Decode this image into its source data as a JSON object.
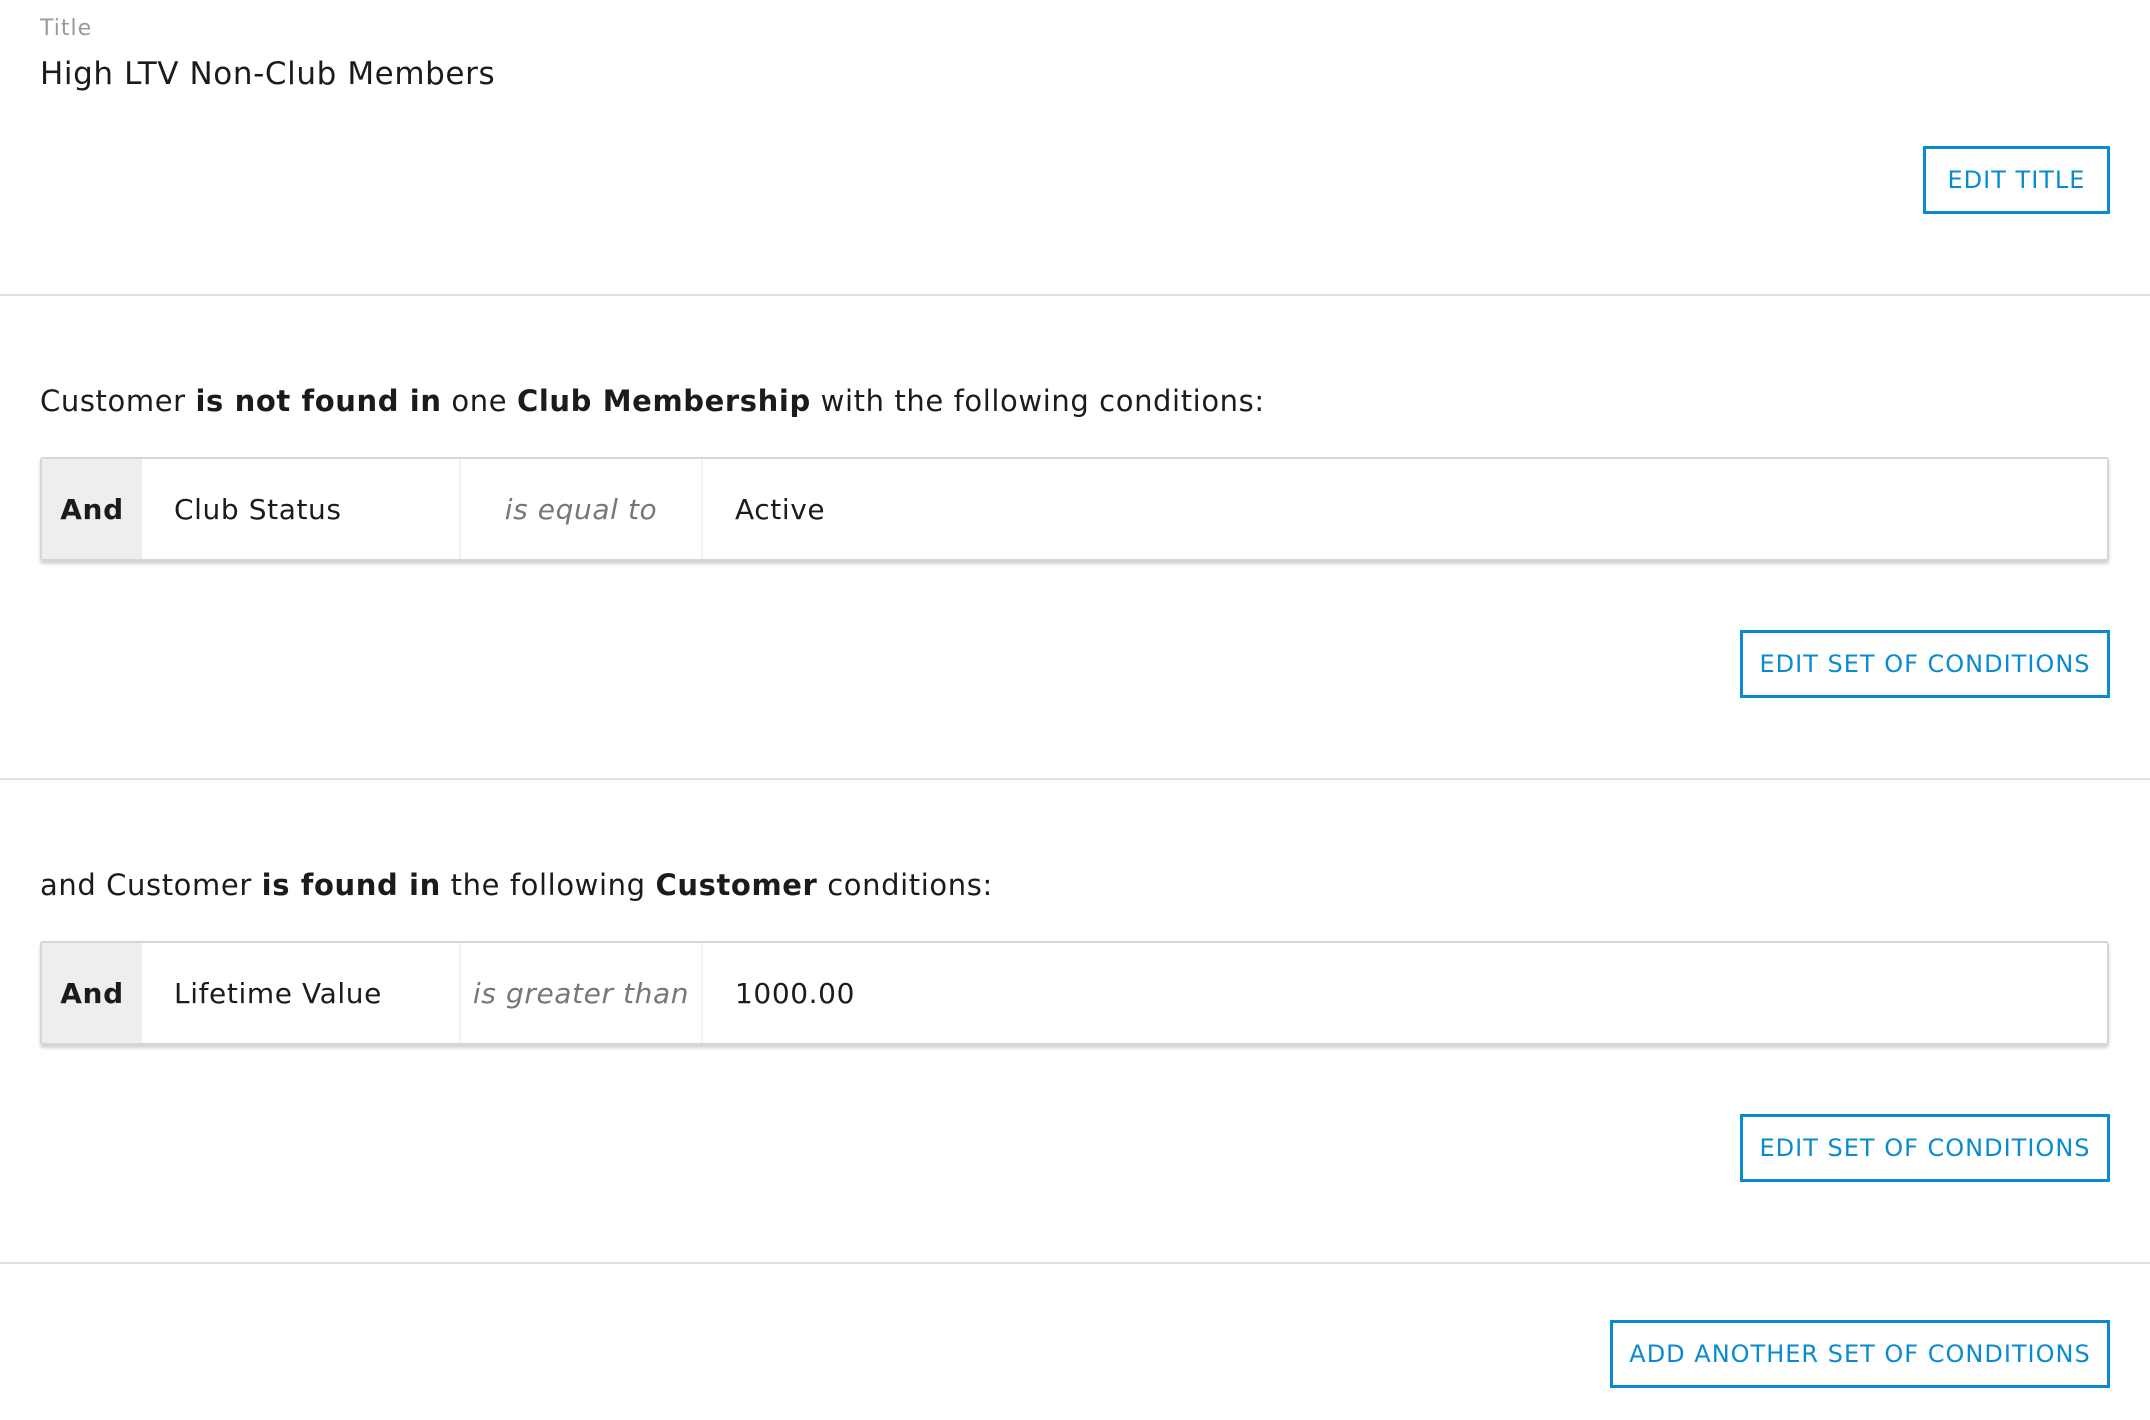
{
  "title_section": {
    "label": "Title",
    "value": "High LTV Non-Club Members",
    "edit_button": "EDIT TITLE"
  },
  "condition_sets": [
    {
      "sentence": {
        "prefix": "Customer ",
        "emph1": "is not found in",
        "mid": " one ",
        "emph2": "Club Membership",
        "suffix": " with the following conditions:"
      },
      "conditions": [
        {
          "conjunction": "And",
          "field": "Club Status",
          "operator": "is equal to",
          "value": "Active"
        }
      ],
      "edit_button": "EDIT SET OF CONDITIONS"
    },
    {
      "sentence": {
        "prefix": "and Customer ",
        "emph1": "is found in",
        "mid": " the following ",
        "emph2": "Customer",
        "suffix": " conditions:"
      },
      "conditions": [
        {
          "conjunction": "And",
          "field": "Lifetime Value",
          "operator": "is greater than",
          "value": "1000.00"
        }
      ],
      "edit_button": "EDIT SET OF CONDITIONS"
    }
  ],
  "add_button": "ADD ANOTHER SET OF CONDITIONS",
  "colors": {
    "accent": "#0a8bcf",
    "divider": "#e1e1e1",
    "conjunction_bg": "#eeeeee",
    "operator_text": "#777777"
  }
}
